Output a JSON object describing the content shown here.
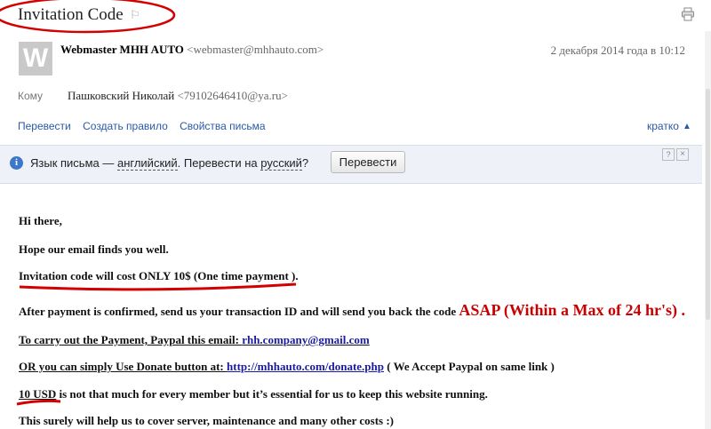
{
  "subject": "Invitation Code",
  "sender": {
    "avatar_letter": "W",
    "name": "Webmaster MHH AUTO",
    "email": "<webmaster@mhhauto.com>",
    "date": "2 декабря 2014 года в 10:12"
  },
  "recipient": {
    "label": "Кому",
    "name": "Пашковский Николай",
    "email": "<79102646410@ya.ru>"
  },
  "actions": {
    "translate": "Перевести",
    "create_rule": "Создать правило",
    "properties": "Свойства письма",
    "short": "кратко"
  },
  "translate_bar": {
    "prefix": "Язык письма — ",
    "language": "английский",
    "middle": ". Перевести на ",
    "target": "русский",
    "suffix": "?",
    "button": "Перевести",
    "help": "?",
    "close": "×"
  },
  "body": {
    "greeting": "Hi there,",
    "hope": "Hope our email finds you well.",
    "cost": "Invitation code will cost ONLY 10$ (One time payment ).",
    "after_a": "After payment is confirmed, send us your transaction ID and will send you back the code ",
    "after_asap": "ASAP (Within a Max of 24 hr's) .",
    "paypal_prefix": "To carry out the Payment, Paypal this email: ",
    "paypal_email": "rhh.company@gmail.com",
    "donate_prefix": "OR you can simply Use Donate button at: ",
    "donate_url": "http://mhhauto.com/donate.php",
    "donate_suffix": " ( We Accept Paypal on same link )",
    "usd_amount": "10 USD",
    "usd_rest": " is not that much for every member but it’s essential for us to keep this website running.",
    "last": "This surely will help us to cover server, maintenance and many other costs :)"
  },
  "colors": {
    "link": "#2b58a8",
    "annotation": "#d40000"
  }
}
